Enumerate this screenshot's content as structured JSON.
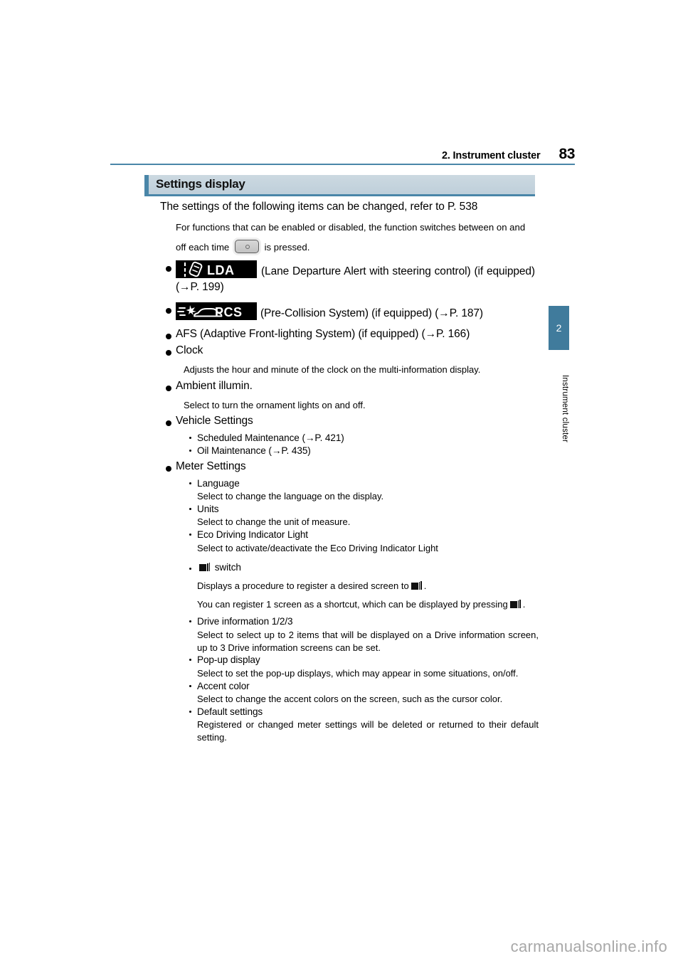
{
  "header": {
    "section_title": "2. Instrument cluster",
    "page_number": "83"
  },
  "chapter_tab": {
    "number": "2",
    "label": "Instrument cluster"
  },
  "section": {
    "title": "Settings display",
    "lead": "The settings of the following items can be changed, refer to P. 538",
    "intro_line1": "For functions that can be enabled or disabled, the function switches between on and",
    "intro_line2_prefix": "off each time",
    "intro_line2_suffix": "is pressed."
  },
  "badges": {
    "lda": "LDA",
    "pcs": "PCS"
  },
  "items": [
    {
      "badge": "lda",
      "text": "(Lane Departure Alert with steering control) (if equipped) (→P. 199)"
    },
    {
      "badge": "pcs",
      "text": "(Pre-Collision System) (if equipped) (→P. 187)"
    },
    {
      "text": "AFS (Adaptive Front-lighting System) (if equipped) (→P. 166)"
    },
    {
      "text": "Clock",
      "desc": "Adjusts the hour and minute of the clock on the multi-information display."
    },
    {
      "text": "Ambient illumin.",
      "desc": "Select to turn the ornament lights on and off."
    },
    {
      "text": "Vehicle Settings",
      "sub": [
        {
          "text": "Scheduled Maintenance (→P. 421)"
        },
        {
          "text": "Oil Maintenance (→P. 435)"
        }
      ]
    },
    {
      "text": "Meter Settings",
      "sub": [
        {
          "text": "Language",
          "desc": "Select to change the language on the display."
        },
        {
          "text": "Units",
          "desc": "Select to change the unit of measure."
        },
        {
          "text": "Eco Driving Indicator Light",
          "desc": "Select to activate/deactivate the Eco Driving Indicator Light"
        },
        {
          "text_suffix": "switch",
          "icon": "screens-icon",
          "desc_prefix": "Displays a procedure to register a desired screen to",
          "desc_suffix": ".",
          "note_prefix": "You can register 1 screen as a shortcut, which can be displayed by pressing",
          "note_suffix": "."
        },
        {
          "text": "Drive information 1/2/3",
          "desc": "Select to select up to 2 items that will be displayed on a Drive information screen, up to 3 Drive information screens can be set."
        },
        {
          "text": "Pop-up display",
          "desc": "Select to set the pop-up displays, which may appear in some situations, on/off."
        },
        {
          "text": "Accent color",
          "desc": "Select to change the accent colors on the screen, such as the cursor color."
        },
        {
          "text": "Default settings",
          "desc": "Registered or changed meter settings will be deleted or returned to their default setting."
        }
      ]
    }
  ],
  "footer": {
    "watermark": "carmanualsonline.info"
  },
  "colors": {
    "accent_blue": "#4a86a8",
    "tab_blue": "#407b9c",
    "band_fill": "#c6d4de"
  }
}
